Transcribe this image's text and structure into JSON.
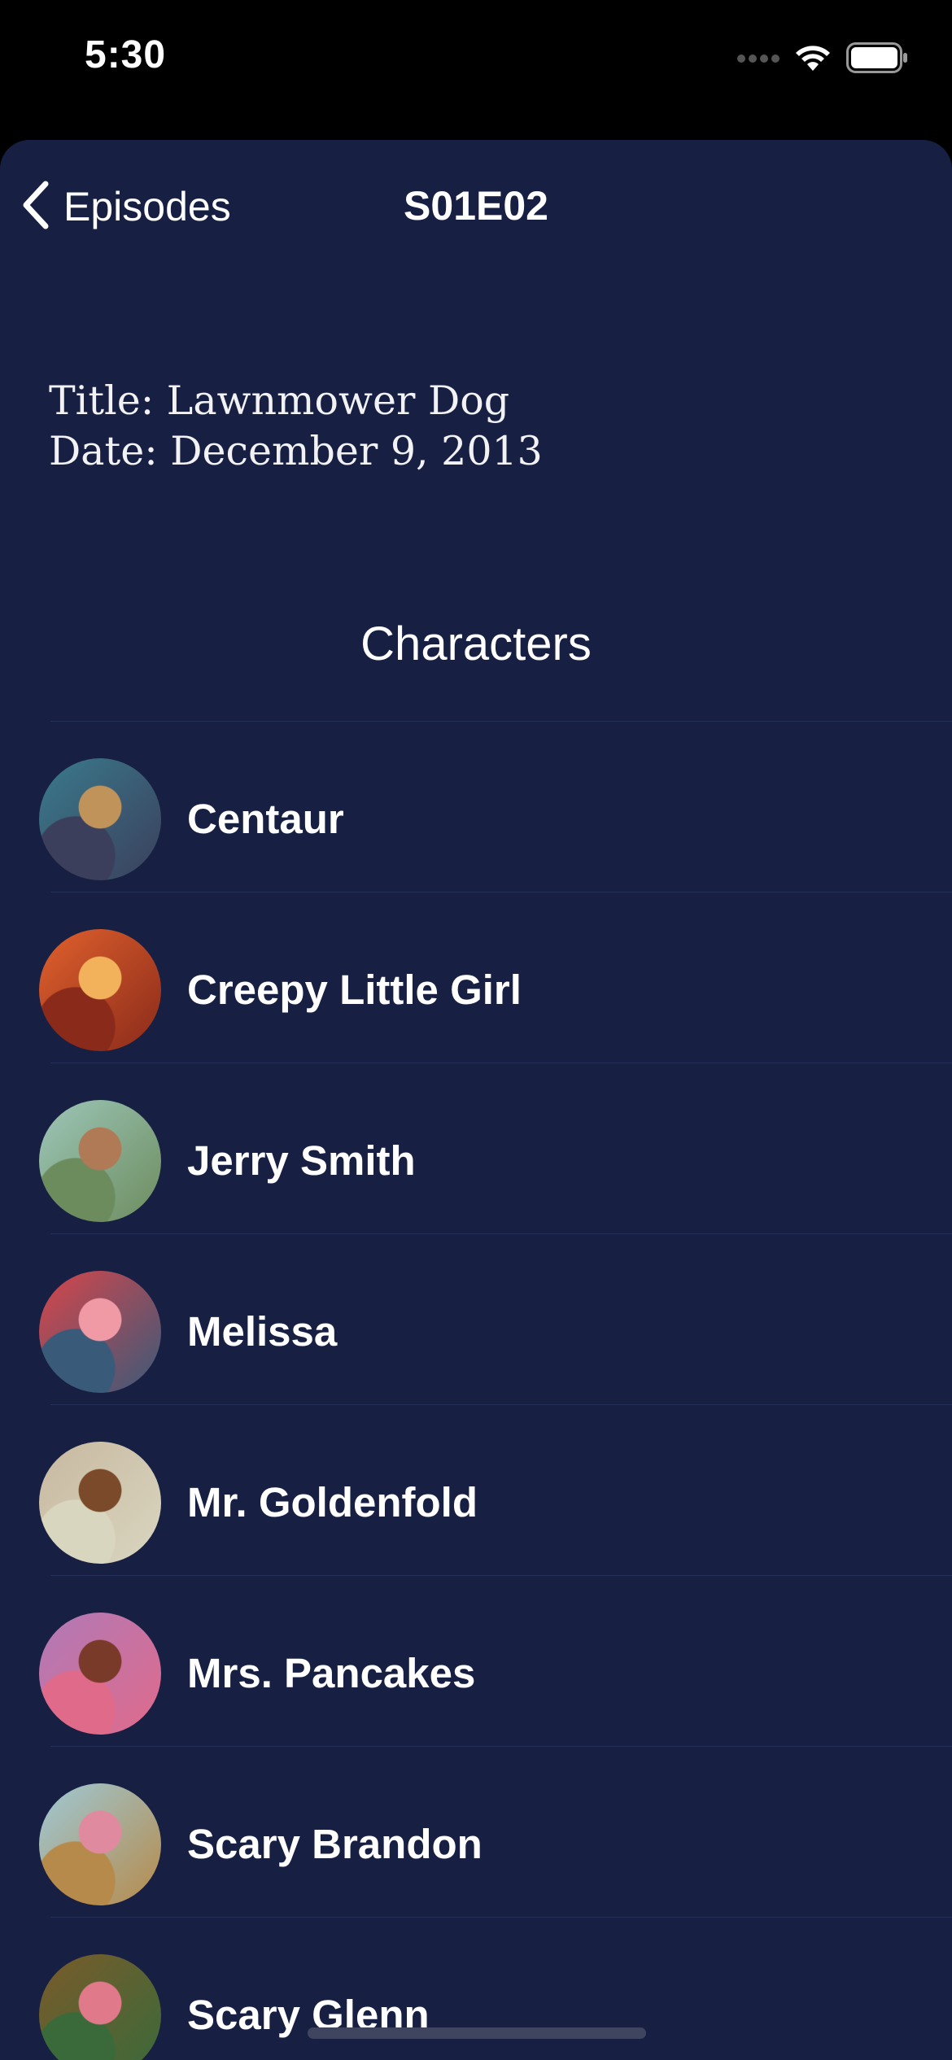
{
  "status_bar": {
    "time": "5:30"
  },
  "nav": {
    "back_label": "Episodes",
    "title": "S01E02"
  },
  "episode": {
    "title_line": "Title: Lawnmower Dog",
    "date_line": "Date: December 9, 2013"
  },
  "characters_section": {
    "title": "Characters",
    "items": [
      {
        "name": "Centaur",
        "avatar_colors": [
          "#3a7a8c",
          "#c0935a",
          "#3b3f5c"
        ]
      },
      {
        "name": "Creepy Little Girl",
        "avatar_colors": [
          "#e0612d",
          "#f2b25c",
          "#8a2a1a"
        ]
      },
      {
        "name": "Jerry Smith",
        "avatar_colors": [
          "#9cc6b8",
          "#b07a56",
          "#6d8c5e"
        ]
      },
      {
        "name": "Melissa",
        "avatar_colors": [
          "#d8454a",
          "#f09aa6",
          "#3a5a7a"
        ]
      },
      {
        "name": "Mr. Goldenfold",
        "avatar_colors": [
          "#c8b8a0",
          "#7a4a2a",
          "#d9d6c0"
        ]
      },
      {
        "name": "Mrs. Pancakes",
        "avatar_colors": [
          "#b07ab8",
          "#7a3a2a",
          "#e06a8a"
        ]
      },
      {
        "name": "Scary Brandon",
        "avatar_colors": [
          "#9ec9d6",
          "#e08aa0",
          "#b68a4a"
        ]
      },
      {
        "name": "Scary Glenn",
        "avatar_colors": [
          "#7a5a2a",
          "#e07a8a",
          "#3a6a3a"
        ]
      }
    ]
  },
  "colors": {
    "background": "#172043",
    "status_bar": "#000000",
    "text": "#ffffff",
    "separator": "#24305a"
  }
}
